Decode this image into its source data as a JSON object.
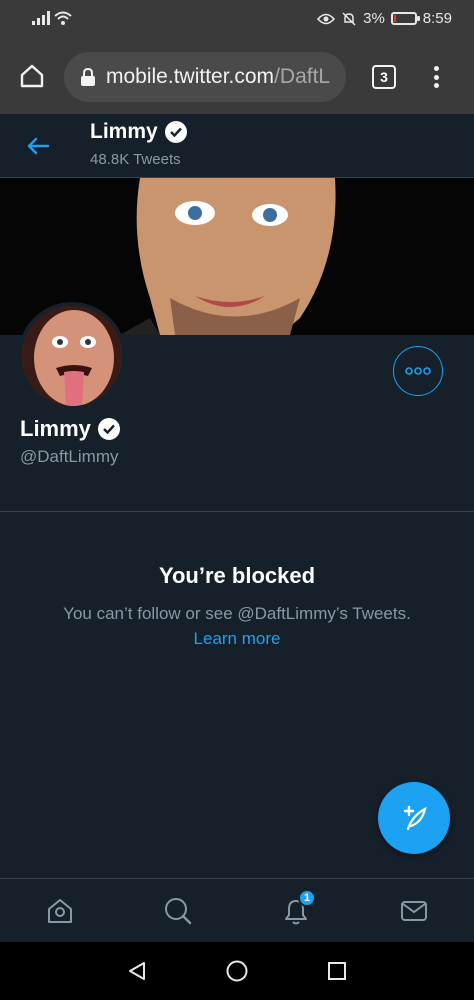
{
  "status_bar": {
    "battery": "3%",
    "time": "8:59",
    "battery_level": 0.03
  },
  "browser": {
    "url_domain": "mobile.twitter.com",
    "url_path": "/DaftL",
    "tab_count": "3"
  },
  "header": {
    "name": "Limmy",
    "tweet_count": "48.8K Tweets"
  },
  "profile": {
    "name": "Limmy",
    "handle": "@DaftLimmy"
  },
  "blocked": {
    "title": "You’re blocked",
    "description": "You can’t follow or see @DaftLimmy’s Tweets.",
    "learn_more": "Learn more"
  },
  "bottom_nav": {
    "items": [
      "home-icon",
      "search-icon",
      "notifications-icon",
      "messages-icon"
    ],
    "notification_badge": "1"
  },
  "colors": {
    "accent": "#1da1f2",
    "background": "#15202b",
    "muted": "#8899a6"
  }
}
